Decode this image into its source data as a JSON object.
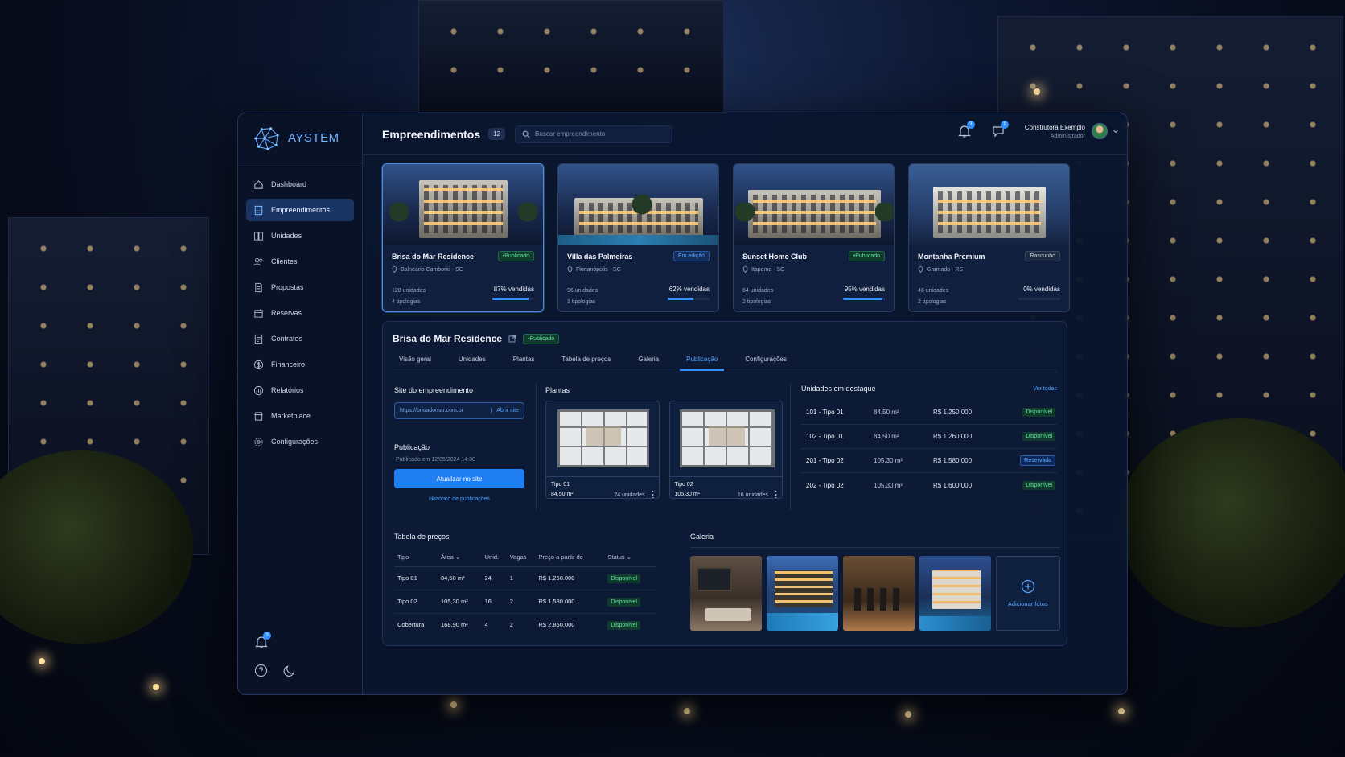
{
  "app": {
    "brand": "AYSTEM"
  },
  "sidebar": {
    "items": [
      {
        "label": "Dashboard",
        "icon": "home-icon"
      },
      {
        "label": "Empreendimentos",
        "icon": "building-icon",
        "active": true
      },
      {
        "label": "Unidades",
        "icon": "units-icon"
      },
      {
        "label": "Clientes",
        "icon": "users-icon"
      },
      {
        "label": "Propostas",
        "icon": "document-icon"
      },
      {
        "label": "Reservas",
        "icon": "calendar-icon"
      },
      {
        "label": "Contratos",
        "icon": "contract-icon"
      },
      {
        "label": "Financeiro",
        "icon": "dollar-icon"
      },
      {
        "label": "Relatórios",
        "icon": "chart-icon"
      },
      {
        "label": "Marketplace",
        "icon": "store-icon"
      },
      {
        "label": "Configurações",
        "icon": "gear-icon"
      }
    ],
    "notifications_count": "3"
  },
  "header": {
    "title": "Empreendimentos",
    "count": "12",
    "search_placeholder": "Buscar empreendimento",
    "notifications_count": "3",
    "messages_count": "1",
    "user_name": "Construtora Exemplo",
    "user_role": "Administrador"
  },
  "projects": [
    {
      "name": "Brisa do Mar Residence",
      "status": "Publicado",
      "location": "Balneário Camboriú - SC",
      "units": "128 unidades",
      "types": "4 tipologias",
      "sold": "87% vendidas",
      "sold_pct": 87
    },
    {
      "name": "Villa das Palmeiras",
      "status": "Em edição",
      "location": "Florianópolis - SC",
      "units": "96 unidades",
      "types": "3 tipologias",
      "sold": "62% vendidas",
      "sold_pct": 62
    },
    {
      "name": "Sunset Home Club",
      "status": "Publicado",
      "location": "Itapema - SC",
      "units": "64 unidades",
      "types": "2 tipologias",
      "sold": "95% vendidas",
      "sold_pct": 95
    },
    {
      "name": "Montanha Premium",
      "status": "Rascunho",
      "location": "Gramado - RS",
      "units": "48 unidades",
      "types": "2 tipologias",
      "sold": "0% vendidas",
      "sold_pct": 0
    }
  ],
  "detail": {
    "title": "Brisa do Mar Residence",
    "status": "Publicado",
    "tabs": [
      "Visão geral",
      "Unidades",
      "Plantas",
      "Tabela de preços",
      "Galeria",
      "Publicação",
      "Configurações"
    ],
    "active_tab": "Publicação",
    "site": {
      "title": "Site do empreendimento",
      "url": "https://brisadomar.com.br",
      "open_label": "Abrir site"
    },
    "publication": {
      "title": "Publicação",
      "date": "Publicado em 12/05/2024 14:30",
      "update_button": "Atualizar no site",
      "history_link": "Histórico de publicações"
    },
    "plans": {
      "title": "Plantas",
      "items": [
        {
          "name": "Tipo 01",
          "area": "84,50 m²",
          "units": "24 unidades"
        },
        {
          "name": "Tipo 02",
          "area": "105,30 m²",
          "units": "16 unidades"
        }
      ]
    },
    "featured_units": {
      "title": "Unidades em destaque",
      "see_all": "Ver todas",
      "rows": [
        {
          "name": "101 - Tipo 01",
          "area": "84,50 m²",
          "price": "R$ 1.250.000",
          "status": "Disponível"
        },
        {
          "name": "102 - Tipo 01",
          "area": "84,50 m²",
          "price": "R$ 1.260.000",
          "status": "Disponível"
        },
        {
          "name": "201 - Tipo 02",
          "area": "105,30 m²",
          "price": "R$ 1.580.000",
          "status": "Reservada"
        },
        {
          "name": "202 - Tipo 02",
          "area": "105,30 m²",
          "price": "R$ 1.600.000",
          "status": "Disponível"
        }
      ]
    },
    "price_table": {
      "title": "Tabela de preços",
      "headers": [
        "Tipo",
        "Área",
        "Unid.",
        "Vagas",
        "Preço a partir de",
        "Status"
      ],
      "rows": [
        [
          "Tipo 01",
          "84,50 m²",
          "24",
          "1",
          "R$ 1.250.000",
          "Disponível"
        ],
        [
          "Tipo 02",
          "105,30 m²",
          "16",
          "2",
          "R$ 1.580.000",
          "Disponível"
        ],
        [
          "Cobertura",
          "168,90 m²",
          "4",
          "2",
          "R$ 2.850.000",
          "Disponível"
        ]
      ]
    },
    "gallery": {
      "title": "Galeria",
      "add_label": "Adicionar fotos"
    }
  },
  "colors": {
    "accent": "#2f8fff",
    "published": "#5ee39a",
    "editing": "#5ea8ff",
    "panel": "#0a162e"
  }
}
